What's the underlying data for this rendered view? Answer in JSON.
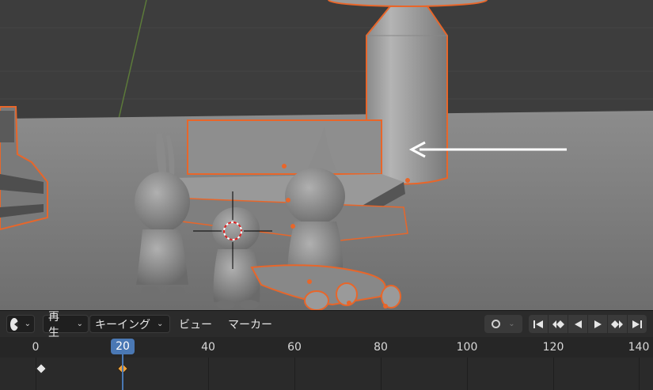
{
  "timeline": {
    "menu_editor_icon": "clock-icon",
    "play_label": "再生",
    "keying_label": "キーイング",
    "view_label": "ビュー",
    "marker_label": "マーカー",
    "current_frame": "20",
    "ruler_ticks": [
      "0",
      "40",
      "60",
      "80",
      "100",
      "120",
      "140"
    ],
    "accent_color": "#4a78b4"
  },
  "viewport": {
    "selection_outline_color": "#e8662a"
  }
}
